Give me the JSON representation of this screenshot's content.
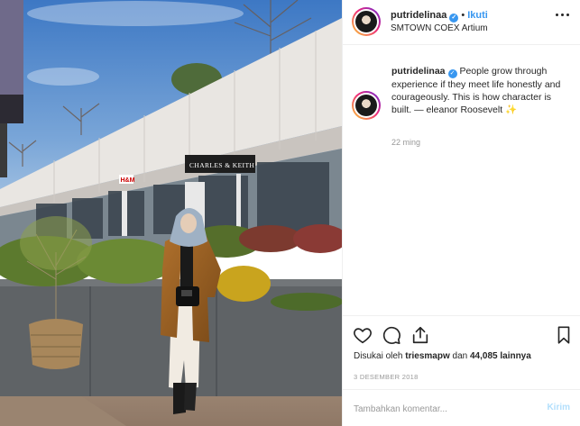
{
  "photo": {
    "store_sign": "CHARLES & KEITH",
    "hm_sign": "H&M"
  },
  "header": {
    "username": "putridelinaa",
    "follow_label": "Ikuti",
    "location": "SMTOWN COEX Artium"
  },
  "caption": {
    "username": "putridelinaa",
    "text": "People grow through experience if they meet life honestly and courageously. This is how character is built. — eleanor Roosevelt",
    "emoji": "✨",
    "time": "22 ming"
  },
  "actions": {
    "icons": [
      "heart-icon",
      "comment-icon",
      "share-icon",
      "bookmark-icon"
    ]
  },
  "likes": {
    "prefix": "Disukai oleh",
    "user": "triesmapw",
    "middle": "dan",
    "count": "44,085 lainnya"
  },
  "date": "3 DESEMBER 2018",
  "comment": {
    "placeholder": "Tambahkan komentar...",
    "post_label": "Kirim"
  },
  "colors": {
    "accent": "#3897f0",
    "muted": "#999999",
    "post_disabled": "#b2dffc"
  }
}
